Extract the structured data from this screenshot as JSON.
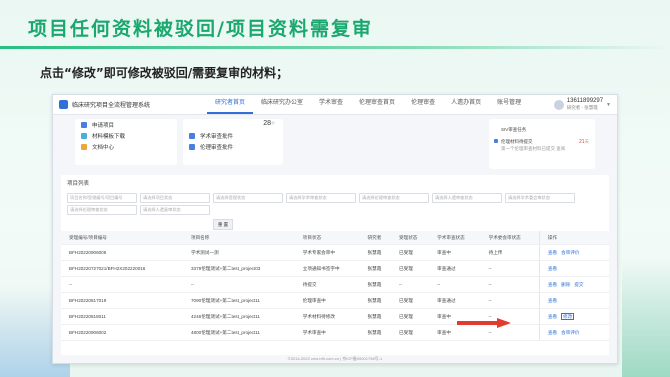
{
  "slide": {
    "title": "项目任何资料被驳回/项目资料需复审",
    "instruction": "点击“修改”即可修改被驳回/需要复审的材料；"
  },
  "app": {
    "name": "临床研究项目全流程管理系统",
    "nav": [
      "研究者首页",
      "临床研究办公室",
      "学术审查",
      "伦理审查首页",
      "伦理审查",
      "人遗办首页",
      "账号管理"
    ],
    "active_nav": 0,
    "user": {
      "phone": "13611899297",
      "role": "研究者 - 张慧霞"
    }
  },
  "cards": {
    "quick_links": [
      {
        "label": "申请项目",
        "icon": "folder-icon"
      },
      {
        "label": "材料模板下载",
        "icon": "download-icon"
      },
      {
        "label": "文档中心",
        "icon": "doc-icon"
      }
    ],
    "approvals": [
      {
        "label": "学术审查批件",
        "icon": "file-icon"
      },
      {
        "label": "伦理审查批件",
        "icon": "file-icon"
      }
    ],
    "count": "28",
    "count_unit": "个",
    "messages": [
      {
        "text": "SIV审查任务",
        "sub": ""
      },
      {
        "text": "伦理材料待提交",
        "sub": "第一个伦理审查材料已提交 查阅",
        "time": "21",
        "time_unit": "天"
      }
    ]
  },
  "list": {
    "title": "项目列表",
    "filters": [
      "项目名称/受理编号/项目编号",
      "请选择项目状态",
      "请选择受理状态",
      "请选择学术审查状态",
      "请选择伦理审查状态",
      "请选择人遗审查状态",
      "请选择学术委会审状态",
      "请选择伦理审查状态",
      "请选择人遗复审状态"
    ],
    "reset_label": "重 置",
    "columns": [
      "受理编号/项目编号",
      "项目名称",
      "项目状态",
      "研究者",
      "受理状态",
      "学术审查状态",
      "学术委会审状态",
      "操作"
    ],
    "rows": [
      {
        "id": "BFH20220906006",
        "name": "学术测试一测",
        "status": "学术专家会审中",
        "pi": "张慧霞",
        "accept": "已受理",
        "academic": "审查中",
        "committee": "待上传",
        "ops": [
          "查看",
          "会审评价"
        ]
      },
      {
        "id": "BFH20220727021/BFH2X202220016",
        "name": "3379伦理测试+第二test_project03",
        "status": "立项通知书签字中",
        "pi": "张慧霞",
        "accept": "已受理",
        "academic": "审查通过",
        "committee": "--",
        "ops": [
          "查看"
        ]
      },
      {
        "id": "--",
        "name": "--",
        "status": "待提交",
        "pi": "张慧霞",
        "accept": "--",
        "academic": "--",
        "committee": "--",
        "ops": [
          "查看",
          "删除",
          "提交"
        ]
      },
      {
        "id": "BFH20220817019",
        "name": "7090伦理测试+第二test_project11",
        "status": "伦理审查中",
        "pi": "张慧霞",
        "accept": "已受理",
        "academic": "审查通过",
        "committee": "--",
        "ops": [
          "查看"
        ]
      },
      {
        "id": "BFH20220818011",
        "name": "4246伦理测试+第二test_project11",
        "status": "学术材料待修改",
        "pi": "张慧霞",
        "accept": "已受理",
        "academic": "审查中",
        "committee": "--",
        "ops": [
          "查看",
          "修改"
        ]
      },
      {
        "id": "BFH20220906002",
        "name": "4800伦理测试+第二test_project11",
        "status": "学术审查中",
        "pi": "张慧霞",
        "accept": "已受理",
        "academic": "审查中",
        "committee": "--",
        "ops": [
          "查看",
          "会审评价"
        ]
      }
    ],
    "highlight_row": 4
  },
  "footer": "©2014-2022 cms.bfh.com.cn | 京ICP备05001756号-1",
  "colors": {
    "accent": "#2f6fd6",
    "title_green": "#1aa86f",
    "highlight": "#e23a2f"
  }
}
